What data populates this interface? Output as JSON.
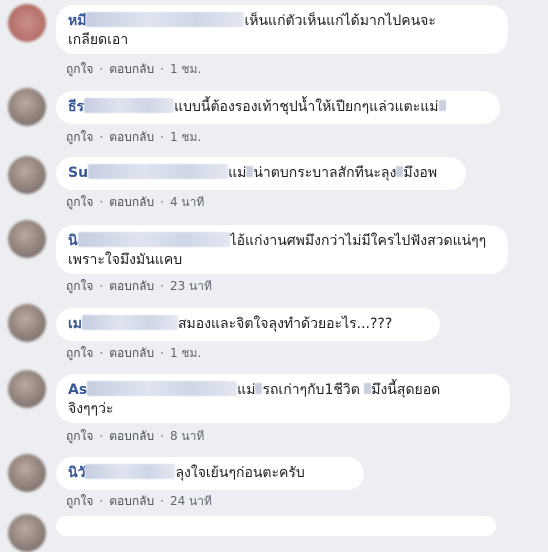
{
  "comments": [
    {
      "author": "หมี",
      "text": "เห็นแก่ตัวเห็นแก่ได้มากไปคนจะเกลียดเอา",
      "line1": "เห็นแก่ตัวเห็นแก่ได้มากไปคนจะ",
      "line2": "เกลียดเอา",
      "like": "ถูกใจ",
      "reply": "ตอบกลับ",
      "time": "1 ชม."
    },
    {
      "author": "ธีร",
      "text": "แบบนี้ต้องรองเท้าชุปน้ำให้เปียกๆแล่วแตะแม่",
      "line1": "แบบนี้ต้องรองเท้าชุปน้ำให้เปียกๆแล่วแตะแม่",
      "like": "ถูกใจ",
      "reply": "ตอบกลับ",
      "time": "1 ชม."
    },
    {
      "author": "Su",
      "text": "แม่ น่าตบกระบาลสักทีนะลุงมึงอพ",
      "line1a": "แม่",
      "line1b": "น่าตบกระบาลสักทีนะลุง",
      "line1c": "มึงอพ",
      "like": "ถูกใจ",
      "reply": "ตอบกลับ",
      "time": "4 นาที"
    },
    {
      "author": "นิ",
      "text": "ไอ้แก่งานศพมึงกว่าไม่มีใครไปฟังสวดแน่ๆๆ เพราะใจมึงมันแคบ",
      "line1": "ไอ้แก่งานศพมึงกว่าไม่มีใครไปฟังสวดแน่ๆๆ",
      "line2": "เพราะใจมึงมันแคบ",
      "like": "ถูกใจ",
      "reply": "ตอบกลับ",
      "time": "23 นาที"
    },
    {
      "author": "เม",
      "text": "สมองและจิตใจลุงทำด้วยอะไร...???",
      "line1": "สมองและจิตใจลุงทำด้วยอะไร...???",
      "like": "ถูกใจ",
      "reply": "ตอบกลับ",
      "time": "1 ชม."
    },
    {
      "author": "As",
      "text": "แม่ รถเก่าๆกับ1ชีวิต มึงนี้สุดยอดจิงๆๆว่ะ",
      "line1a": "แม่",
      "line1b": "รถเก่าๆกับ1ชีวิต",
      "line1c": "มึงนี้สุดยอด",
      "line2": "จิงๆๆว่ะ",
      "like": "ถูกใจ",
      "reply": "ตอบกลับ",
      "time": "8 นาที"
    },
    {
      "author": "นิวั",
      "text": "ลุงใจเย้นๆก่อนตะครับ",
      "line1": "ลุงใจเย้นๆก่อนตะครับ",
      "like": "ถูกใจ",
      "reply": "ตอบกลับ",
      "time": "24 นาที"
    }
  ]
}
